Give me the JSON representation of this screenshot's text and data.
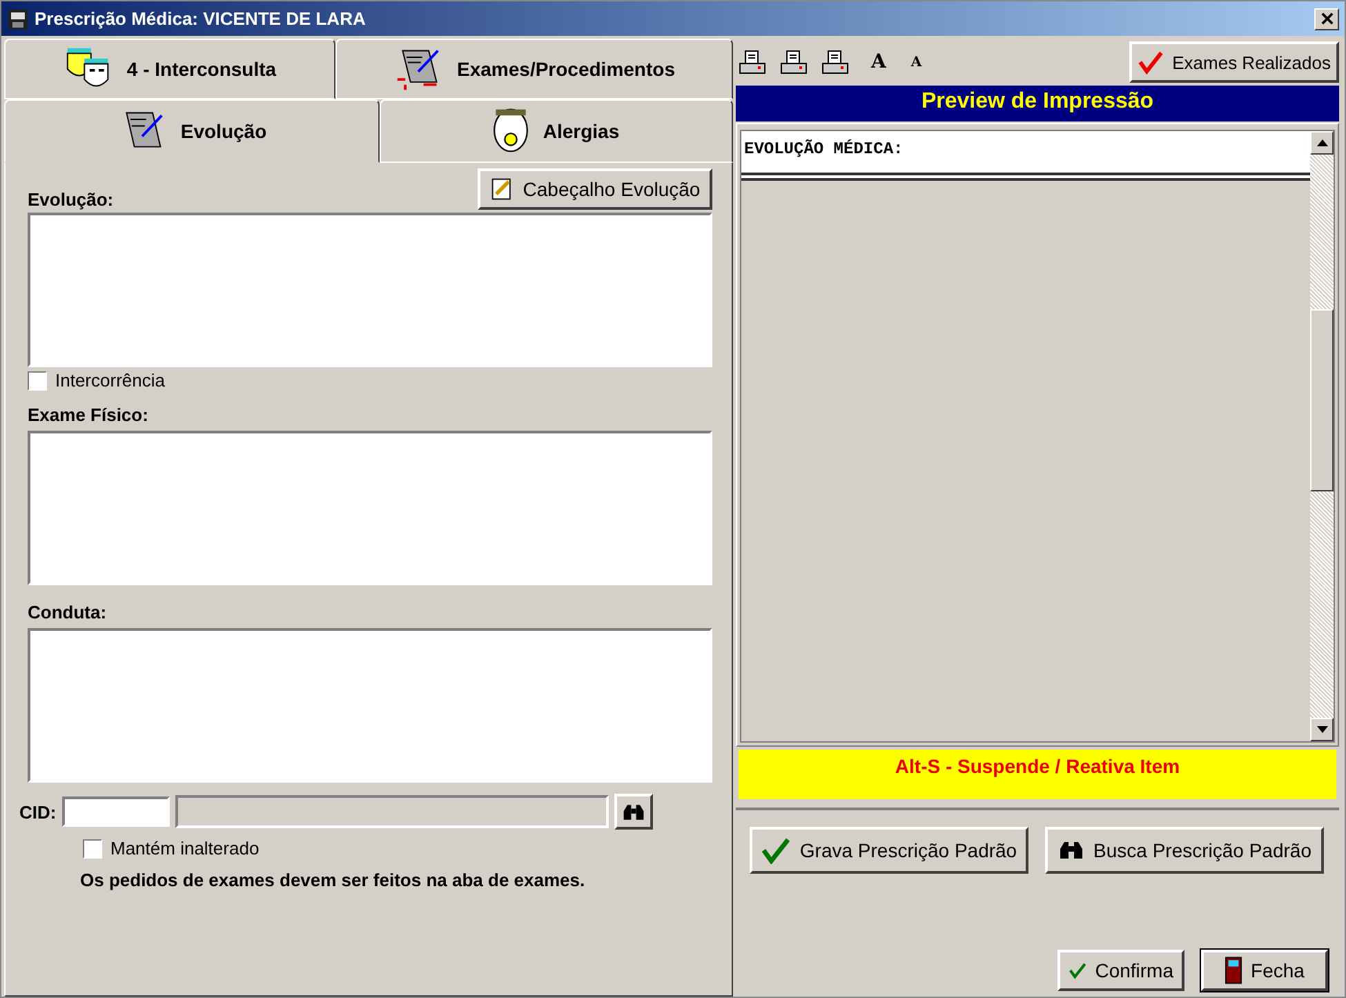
{
  "window": {
    "title": "Prescrição Médica: VICENTE DE LARA"
  },
  "tab_rows": [
    {
      "tabs": [
        {
          "label": "4 - Interconsulta",
          "kind": "masks",
          "selected": false
        },
        {
          "label": "Exames/Procedimentos",
          "kind": "exams",
          "selected": false
        }
      ]
    },
    {
      "tabs": [
        {
          "label": "Evolução",
          "kind": "note",
          "selected": true
        },
        {
          "label": "Alergias",
          "kind": "face",
          "selected": false
        }
      ]
    }
  ],
  "header_button": "Cabeçalho Evolução",
  "evolucao": {
    "label": "Evolução:"
  },
  "intercorrencia": {
    "label": "Intercorrência",
    "checked": false
  },
  "exame_fisico": {
    "label": "Exame Físico:"
  },
  "conduta": {
    "label": "Conduta:"
  },
  "cid": {
    "label": "CID:"
  },
  "mantem": {
    "label": "Mantém inalterado",
    "checked": false
  },
  "note": "Os pedidos de exames devem ser feitos na aba de exames.",
  "toolbar": [
    {
      "kind": "printer"
    },
    {
      "kind": "printer"
    },
    {
      "kind": "printer"
    },
    {
      "kind": "font",
      "label": "A"
    },
    {
      "kind": "font-small",
      "label": "A"
    }
  ],
  "exames_button": "Exames Realizados",
  "preview": {
    "title": "Preview de Impressão",
    "heading": "EVOLUÇÃO MÉDICA:"
  },
  "hint": "Alt-S - Suspende / Reativa Item",
  "buttons": [
    {
      "label": "Grava Prescrição Padrão",
      "kind": "check"
    },
    {
      "label": "Busca Prescrição Padrão",
      "kind": "binoculars"
    }
  ],
  "footer_buttons": [
    {
      "label": "Confirma",
      "kind": "check",
      "selected": false
    },
    {
      "label": "Fecha",
      "kind": "door",
      "selected": true
    }
  ]
}
